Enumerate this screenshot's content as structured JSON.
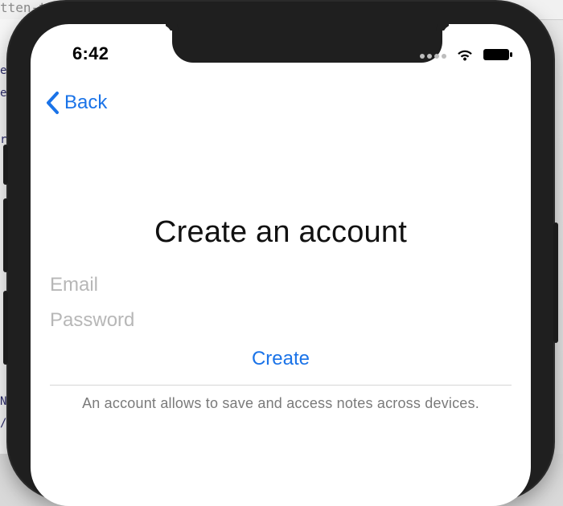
{
  "background": {
    "top_text": "tten-te",
    "left_glyphs": [
      "e",
      "e",
      "r",
      "N",
      "/"
    ]
  },
  "status_bar": {
    "time": "6:42",
    "icons": {
      "signal": "signal-dots-icon",
      "wifi": "wifi-icon",
      "battery": "battery-icon"
    }
  },
  "navigation": {
    "back_label": "Back",
    "back_icon": "chevron-left-icon"
  },
  "screen": {
    "title": "Create an account",
    "email_placeholder": "Email",
    "password_placeholder": "Password",
    "create_label": "Create",
    "footnote": "An account allows to save and access notes across devices."
  },
  "colors": {
    "accent": "#1a73e8",
    "placeholder": "#b7b7b7",
    "muted_text": "#7a7a7a",
    "divider": "#d6d6d6",
    "device_frame": "#1f1f1f"
  }
}
